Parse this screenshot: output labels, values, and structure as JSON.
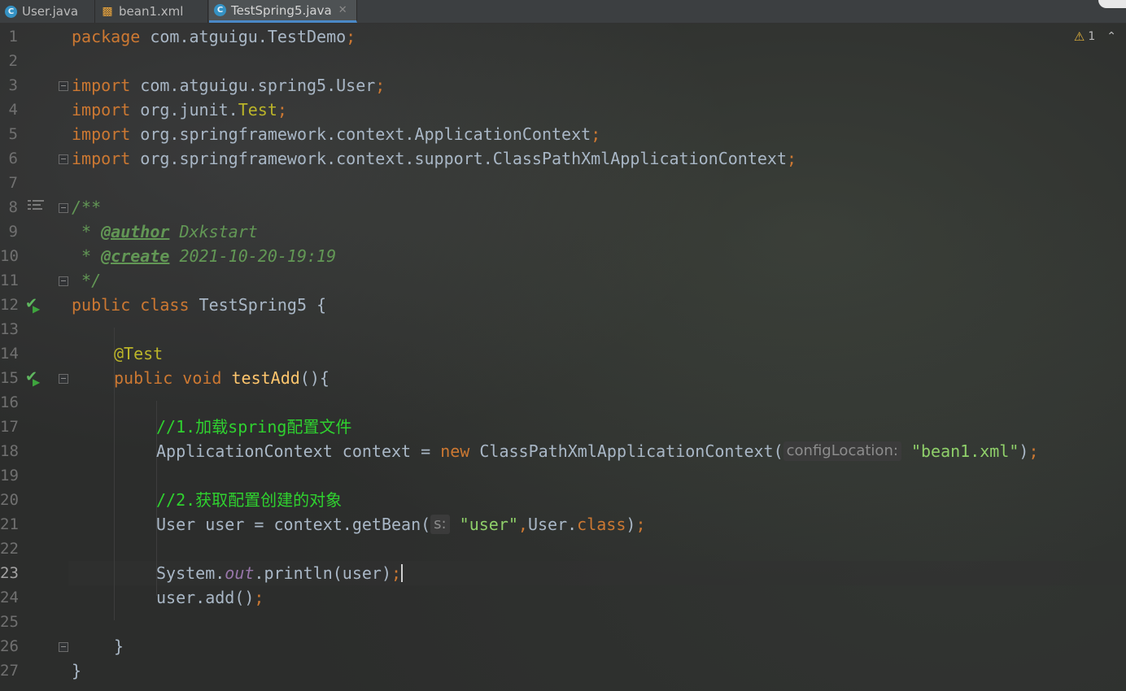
{
  "tabs": [
    {
      "label": "User.java",
      "icon": "java-class-icon",
      "active": false
    },
    {
      "label": "bean1.xml",
      "icon": "xml-file-icon",
      "active": false
    },
    {
      "label": "TestSpring5.java",
      "icon": "java-class-icon",
      "active": true
    }
  ],
  "inspection": {
    "warnings": "1"
  },
  "line_numbers": [
    "1",
    "2",
    "3",
    "4",
    "5",
    "6",
    "7",
    "8",
    "9",
    "10",
    "11",
    "12",
    "13",
    "14",
    "15",
    "16",
    "17",
    "18",
    "19",
    "20",
    "21",
    "22",
    "23",
    "24",
    "25",
    "26",
    "27"
  ],
  "current_line": "23",
  "code": {
    "l1": {
      "kw": "package",
      "id": " com.atguigu.TestDemo",
      "end": ";"
    },
    "l3": {
      "kw": "import",
      "id": " com.atguigu.spring5.User",
      "end": ";"
    },
    "l4": {
      "kw": "import",
      "id": " org.junit.",
      "ann": "Test",
      "end": ";"
    },
    "l5": {
      "kw": "import",
      "id": " org.springframework.context.ApplicationContext",
      "end": ";"
    },
    "l6": {
      "kw": "import",
      "id": " org.springframework.context.support.ClassPathXmlApplicationContext",
      "end": ";"
    },
    "l8": {
      "doc": "/**"
    },
    "l9": {
      "doc": " * ",
      "tag": "@author",
      "val": " Dxkstart"
    },
    "l10": {
      "doc": " * ",
      "tag": "@create",
      "val": " 2021-10-20-19:19"
    },
    "l11": {
      "doc": " */"
    },
    "l12": {
      "kw": "public class",
      "id": " TestSpring5 {"
    },
    "l14": {
      "ann": "@Test"
    },
    "l15": {
      "kw": "public void",
      "fn": " testAdd",
      "id": "(){"
    },
    "l17": {
      "cmt": "//1.加载spring配置文件"
    },
    "l18": {
      "id": "ApplicationContext context = ",
      "kw": "new",
      "id2": " ClassPathXmlApplicationContext(",
      "hint": "configLocation:",
      "str": "\"bean1.xml\"",
      "id3": ")",
      "end": ";"
    },
    "l20": {
      "cmt": "//2.获取配置创建的对象"
    },
    "l21": {
      "id": "User user = context.getBean(",
      "hint": "s:",
      "str": "\"user\"",
      "sep": ",",
      "id2": "User.",
      "kw": "class",
      "id3": ")",
      "end": ";"
    },
    "l23": {
      "id": "System.",
      "static": "out",
      "id2": ".println(user)",
      "end": ";"
    },
    "l24": {
      "id": "user.add()",
      "end": ";"
    },
    "l26": {
      "id": "}"
    },
    "l27": {
      "id": "}"
    }
  }
}
